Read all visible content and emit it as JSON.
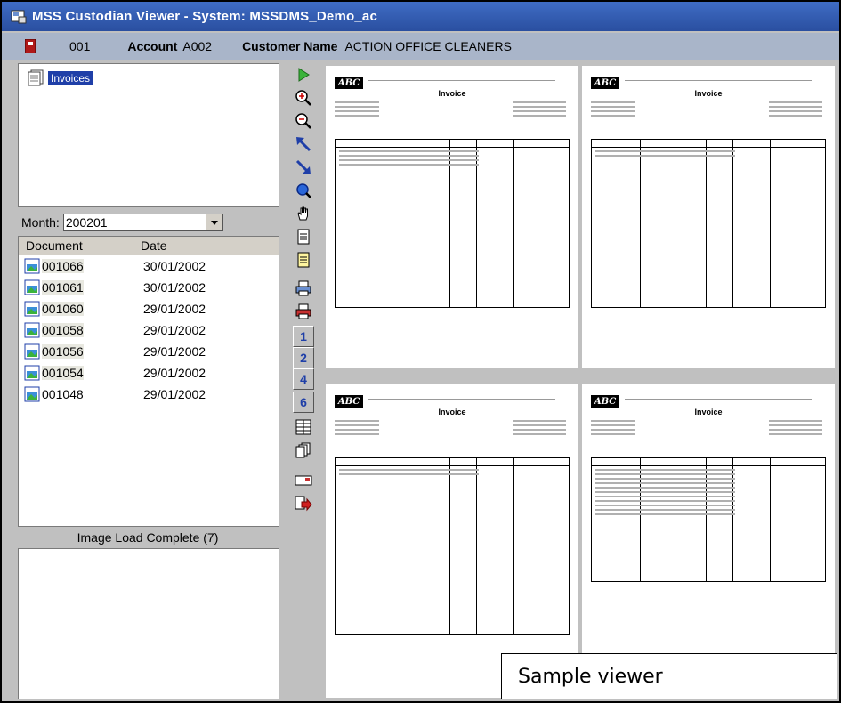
{
  "window": {
    "title": "MSS Custodian Viewer - System: MSSDMS_Demo_ac"
  },
  "infobar": {
    "code": "001",
    "account_label": "Account",
    "account_value": "A002",
    "customer_label": "Customer Name",
    "customer_value": "ACTION OFFICE CLEANERS"
  },
  "tree": {
    "node_label": "Invoices"
  },
  "month": {
    "label": "Month:",
    "value": "200201"
  },
  "documents": {
    "columns": [
      "Document",
      "Date"
    ],
    "rows": [
      {
        "doc": "001066",
        "date": "30/01/2002"
      },
      {
        "doc": "001061",
        "date": "30/01/2002"
      },
      {
        "doc": "001060",
        "date": "29/01/2002"
      },
      {
        "doc": "001058",
        "date": "29/01/2002"
      },
      {
        "doc": "001056",
        "date": "29/01/2002"
      },
      {
        "doc": "001054",
        "date": "29/01/2002"
      },
      {
        "doc": "001048",
        "date": "29/01/2002"
      }
    ]
  },
  "status": {
    "text": "Image Load Complete (7)"
  },
  "toolbar": {
    "page_buttons": [
      "1",
      "2",
      "4",
      "6"
    ]
  },
  "pages": [
    {
      "logo": "ABC",
      "heading": "Invoice"
    },
    {
      "logo": "ABC",
      "heading": "Invoice"
    },
    {
      "logo": "ABC",
      "heading": "Invoice"
    },
    {
      "logo": "ABC",
      "heading": "Invoice"
    }
  ],
  "caption": {
    "text": "Sample viewer"
  },
  "colors": {
    "titlebar": "#2f58b0",
    "infobar": "#a9b5c9",
    "selection": "#1f3fa8",
    "panel": "#c0c0c0"
  }
}
